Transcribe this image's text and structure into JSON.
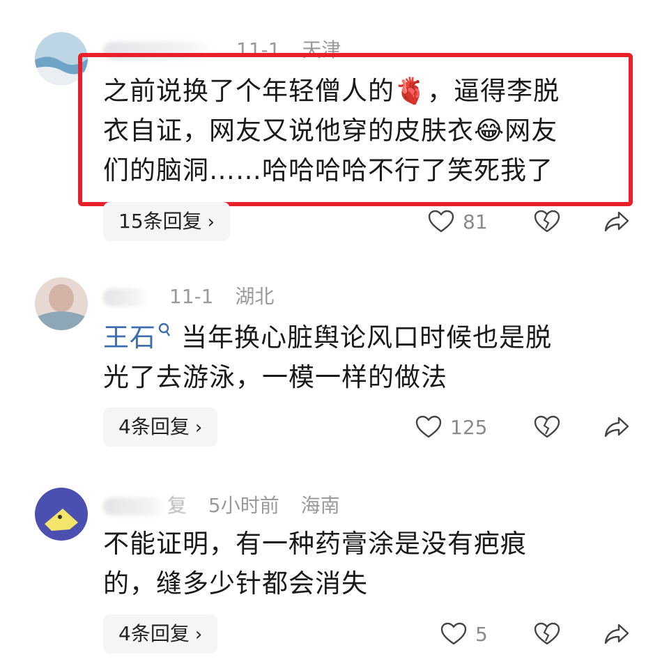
{
  "comments": [
    {
      "date": "11-1",
      "location": "天津",
      "text_lines": [
        "之前说换了个年轻僧人的🫀，逼得李脱",
        "衣自证，网友又说他穿的皮肤衣😂网友",
        "们的脑洞……哈哈哈哈不行了笑死我了"
      ],
      "replies": "15条回复",
      "likes": "81"
    },
    {
      "date": "11-1",
      "location": "湖北",
      "mention": "王石",
      "text_lines": [
        "当年换心脏舆论风口时候也是脱",
        "光了去游泳，一模一样的做法"
      ],
      "replies": "4条回复",
      "likes": "125"
    },
    {
      "name_tail": "复",
      "date": "5小时前",
      "location": "海南",
      "text_lines": [
        "不能证明，有一种药膏涂是没有疤痕",
        "的，缝多少针都会消失"
      ],
      "replies": "4条回复",
      "likes": "5"
    }
  ],
  "colors": {
    "highlight": "#e8202a",
    "mention": "#3d6fb0",
    "meta": "#9a9a9a"
  }
}
